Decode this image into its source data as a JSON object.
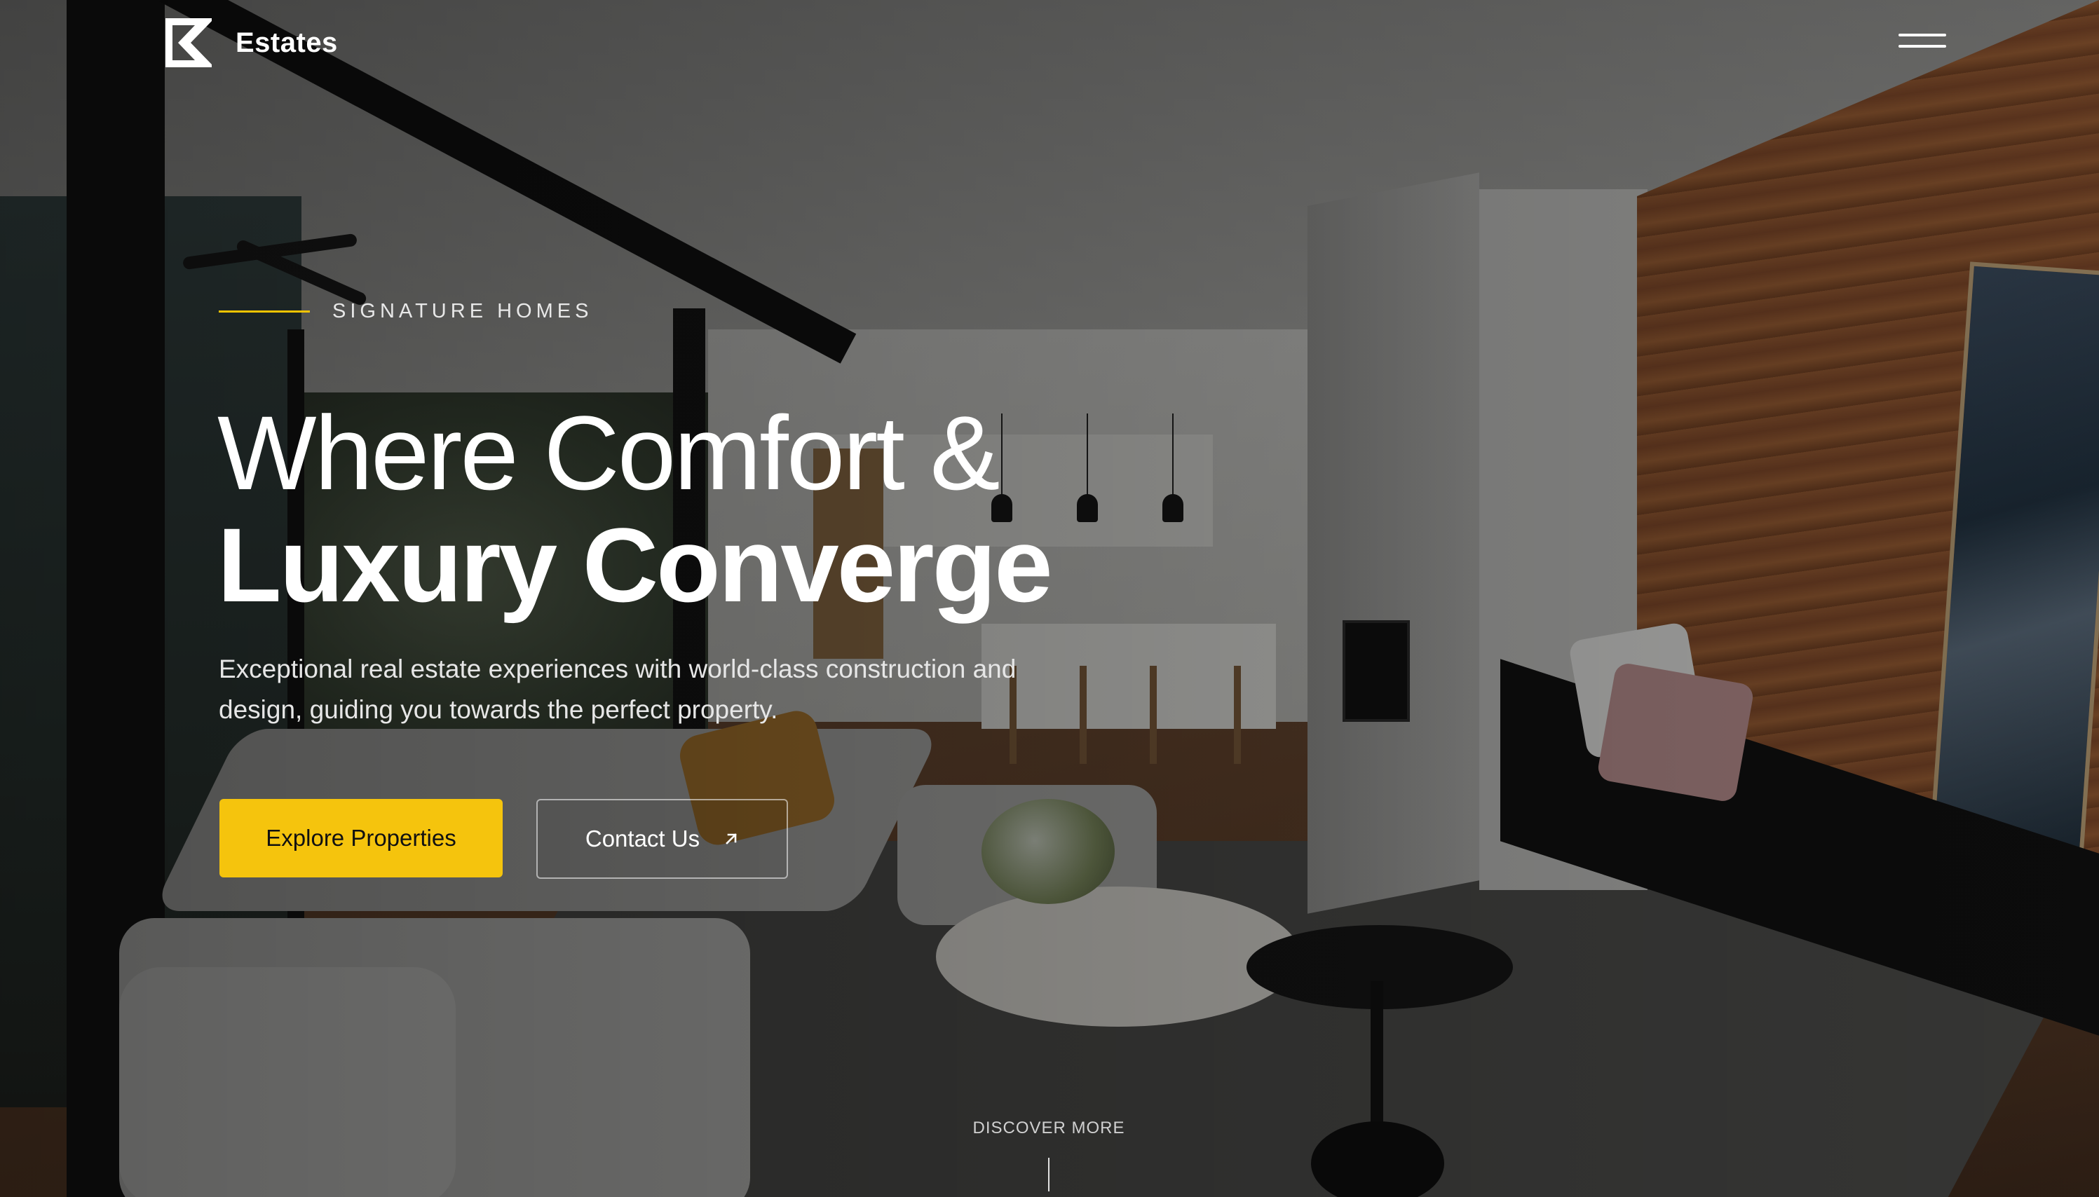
{
  "header": {
    "brand": "Estates",
    "logo_icon": "estates-logo-icon",
    "menu_icon": "hamburger-menu-icon"
  },
  "hero": {
    "eyebrow": "SIGNATURE HOMES",
    "headline_line1": "Where Comfort &",
    "headline_line2": "Luxury Converge",
    "subtitle": "Exceptional real estate experiences with world-class construction and design, guiding you towards the perfect property.",
    "primary_cta": "Explore Properties",
    "secondary_cta": "Contact Us",
    "secondary_cta_icon": "arrow-up-right-icon",
    "scroll_hint": "DISCOVER MORE"
  },
  "colors": {
    "accent": "#f5c40d",
    "text": "#ffffff",
    "overlay": "#000000"
  }
}
